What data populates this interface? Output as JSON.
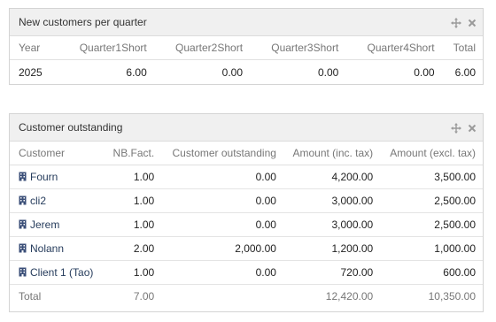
{
  "box1": {
    "title": "New customers per quarter",
    "headers": [
      "Year",
      "Quarter1Short",
      "Quarter2Short",
      "Quarter3Short",
      "Quarter4Short",
      "Total"
    ],
    "rows": [
      [
        "2025",
        "6.00",
        "0.00",
        "0.00",
        "0.00",
        "6.00"
      ]
    ]
  },
  "box2": {
    "title": "Customer outstanding",
    "headers": [
      "Customer",
      "NB.Fact.",
      "Customer outstanding",
      "Amount (inc. tax)",
      "Amount (excl. tax)"
    ],
    "rows": [
      [
        "Fourn",
        "1.00",
        "0.00",
        "4,200.00",
        "3,500.00"
      ],
      [
        "cli2",
        "1.00",
        "0.00",
        "3,000.00",
        "2,500.00"
      ],
      [
        "Jerem",
        "1.00",
        "0.00",
        "3,000.00",
        "2,500.00"
      ],
      [
        "Nolann",
        "2.00",
        "2,000.00",
        "1,200.00",
        "1,000.00"
      ],
      [
        "Client 1 (Tao)",
        "1.00",
        "0.00",
        "720.00",
        "600.00"
      ]
    ],
    "total": [
      "Total",
      "7.00",
      "",
      "12,420.00",
      "10,350.00"
    ]
  },
  "icons": {
    "move": "move-icon",
    "close": "close-icon",
    "customer": "building-icon"
  },
  "colors": {
    "link": "#263c5c",
    "header_bg": "#f0f0f0"
  }
}
